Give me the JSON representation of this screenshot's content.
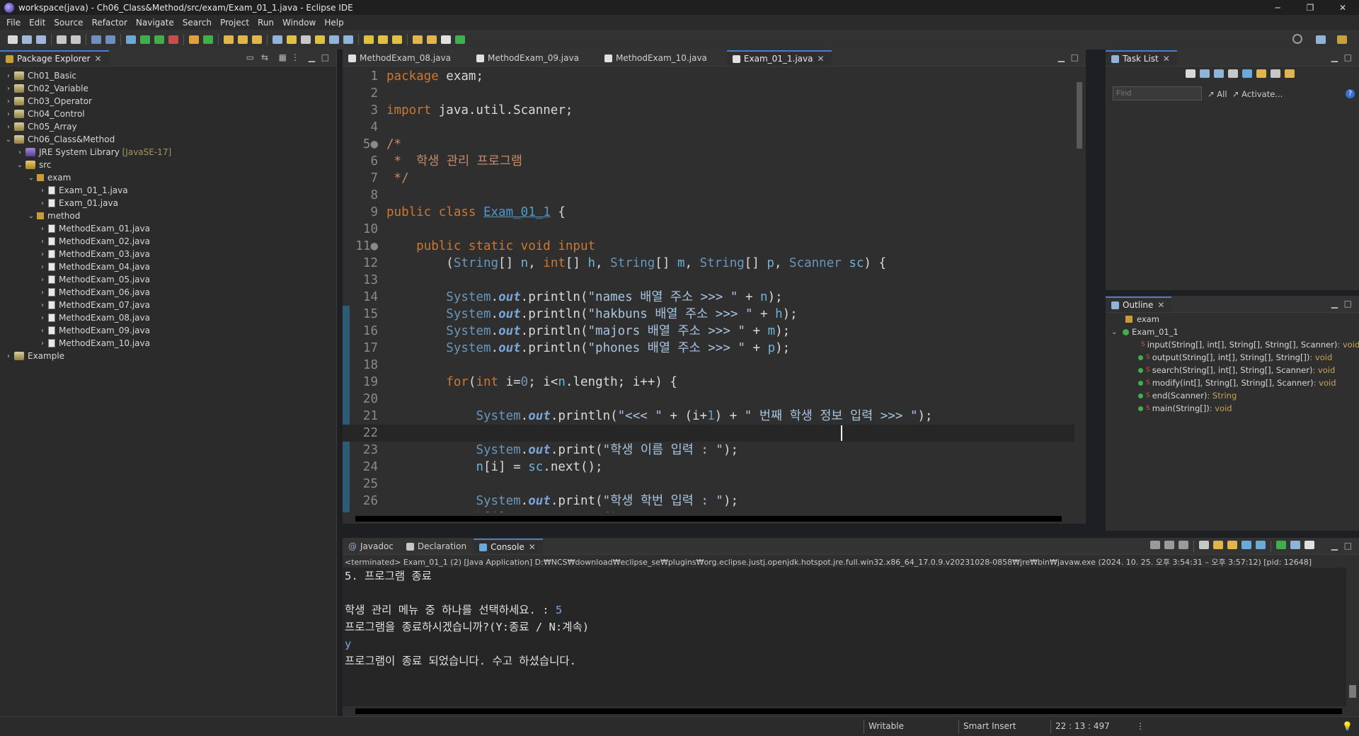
{
  "window": {
    "title": "workspace(java) - Ch06_Class&Method/src/exam/Exam_01_1.java - Eclipse IDE",
    "controls": [
      "─",
      "❐",
      "✕"
    ]
  },
  "menus": [
    "File",
    "Edit",
    "Source",
    "Refactor",
    "Navigate",
    "Search",
    "Project",
    "Run",
    "Window",
    "Help"
  ],
  "package_explorer": {
    "title": "Package Explorer",
    "projects": [
      {
        "label": "Ch01_Basic"
      },
      {
        "label": "Ch02_Variable"
      },
      {
        "label": "Ch03_Operator"
      },
      {
        "label": "Ch04_Control"
      },
      {
        "label": "Ch05_Array"
      },
      {
        "label": "Ch06_Class&Method"
      }
    ],
    "jre": {
      "label": "JRE System Library",
      "version": "[JavaSE-17]"
    },
    "src": "src",
    "pkg_exam": "exam",
    "exam_files": [
      "Exam_01_1.java",
      "Exam_01.java"
    ],
    "pkg_method": "method",
    "method_files": [
      "MethodExam_01.java",
      "MethodExam_02.java",
      "MethodExam_03.java",
      "MethodExam_04.java",
      "MethodExam_05.java",
      "MethodExam_06.java",
      "MethodExam_07.java",
      "MethodExam_08.java",
      "MethodExam_09.java",
      "MethodExam_10.java"
    ],
    "example": "Example"
  },
  "editor": {
    "tabs": [
      "MethodExam_08.java",
      "MethodExam_09.java",
      "MethodExam_10.java",
      "Exam_01_1.java"
    ],
    "active_tab": "Exam_01_1.java"
  },
  "task_list": {
    "title": "Task List",
    "find_placeholder": "Find",
    "all": "All",
    "activate": "Activate..."
  },
  "outline": {
    "title": "Outline",
    "package": "exam",
    "class": "Exam_01_1",
    "methods": [
      {
        "sig": "input(String[], int[], String[], String[], Scanner)",
        "ret": " : void"
      },
      {
        "sig": "output(String[], int[], String[], String[])",
        "ret": " : void"
      },
      {
        "sig": "search(String[], int[], String[], Scanner)",
        "ret": " : void"
      },
      {
        "sig": "modify(int[], String[], String[], Scanner)",
        "ret": " : void"
      },
      {
        "sig": "end(Scanner)",
        "ret": " : String"
      },
      {
        "sig": "main(String[])",
        "ret": " : void"
      }
    ]
  },
  "console": {
    "tabs": [
      "Javadoc",
      "Declaration",
      "Console"
    ],
    "header": "<terminated> Exam_01_1 (2) [Java Application] D:₩NCS₩download₩eclipse_se₩plugins₩org.eclipse.justj.openjdk.hotspot.jre.full.win32.x86_64_17.0.9.v20231028-0858₩jre₩bin₩javaw.exe  (2024. 10. 25. 오후 3:54:31 – 오후 3:57:12) [pid: 12648]",
    "lines": [
      {
        "text": "5. 프로그램 종료"
      },
      {
        "text": ""
      },
      {
        "text": "학생 관리 메뉴 중 하나를 선택하세요. : ",
        "input": "5"
      },
      {
        "text": "프로그램을 종료하시겠습니까?(Y:종료 / N:계속)"
      },
      {
        "text": "",
        "input": "y"
      },
      {
        "text": "프로그램이 종료 되었습니다. 수고 하셨습니다."
      }
    ]
  },
  "status": {
    "writable": "Writable",
    "insert_mode": "Smart Insert",
    "position": "22 : 13 : 497"
  }
}
